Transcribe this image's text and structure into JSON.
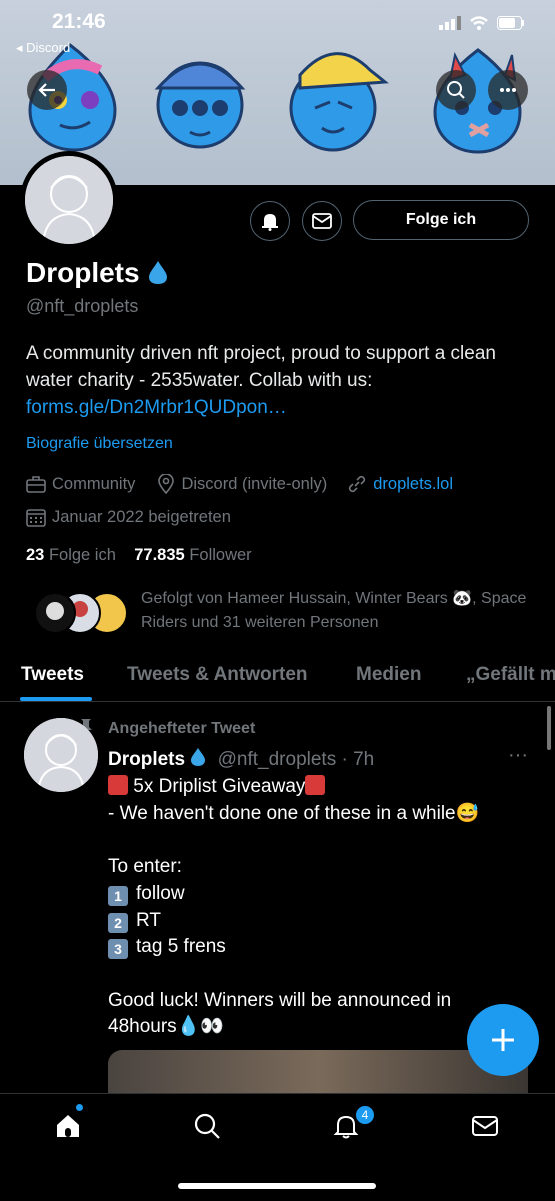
{
  "status": {
    "time": "21:46",
    "back_app": "◂ Discord"
  },
  "profile": {
    "name": "Droplets",
    "handle": "@nft_droplets",
    "bio_text": "A community driven nft project, proud to support a clean water charity - 2535water. Collab with us:",
    "bio_link": "forms.gle/Dn2Mrbr1QUDpon…",
    "translate": "Biografie übersetzen",
    "category": "Community",
    "location": "Discord (invite-only)",
    "website": "droplets.lol",
    "joined": "Januar 2022 beigetreten",
    "following_count": "23",
    "following_label": "Folge ich",
    "followers_count": "77.835",
    "followers_label": "Follower",
    "followed_by": "Gefolgt von Hameer Hussain, Winter Bears 🐼, Space Riders und 31 weiteren Personen",
    "follow_button": "Folge ich"
  },
  "tabs": [
    {
      "label": "Tweets"
    },
    {
      "label": "Tweets & Antworten"
    },
    {
      "label": "Medien"
    },
    {
      "label": "„Gefällt mir“"
    }
  ],
  "tweet": {
    "pinned_label": "Angehefteter Tweet",
    "name": "Droplets",
    "handle": "@nft_droplets · 7h",
    "line1": " 5x Driplist Giveaway",
    "line2": "- We haven't done one of these in a while😅",
    "line3": "To enter:",
    "step1": "follow",
    "step2": "RT",
    "step3": "tag 5 frens",
    "line4": "Good luck! Winners will be announced in",
    "line5": "48hours💧👀",
    "step1_num": "1",
    "step2_num": "2",
    "step3_num": "3"
  },
  "nav": {
    "notifications_badge": "4"
  },
  "icons": [
    "back-arrow-icon",
    "search-icon",
    "more-icon",
    "notification-bell-icon",
    "mail-icon",
    "briefcase-icon",
    "location-pin-icon",
    "link-icon",
    "calendar-icon",
    "pin-icon",
    "plus-icon",
    "home-icon"
  ],
  "colors": {
    "accent": "#1d9bf0",
    "background": "#000000",
    "muted": "#71767b"
  }
}
